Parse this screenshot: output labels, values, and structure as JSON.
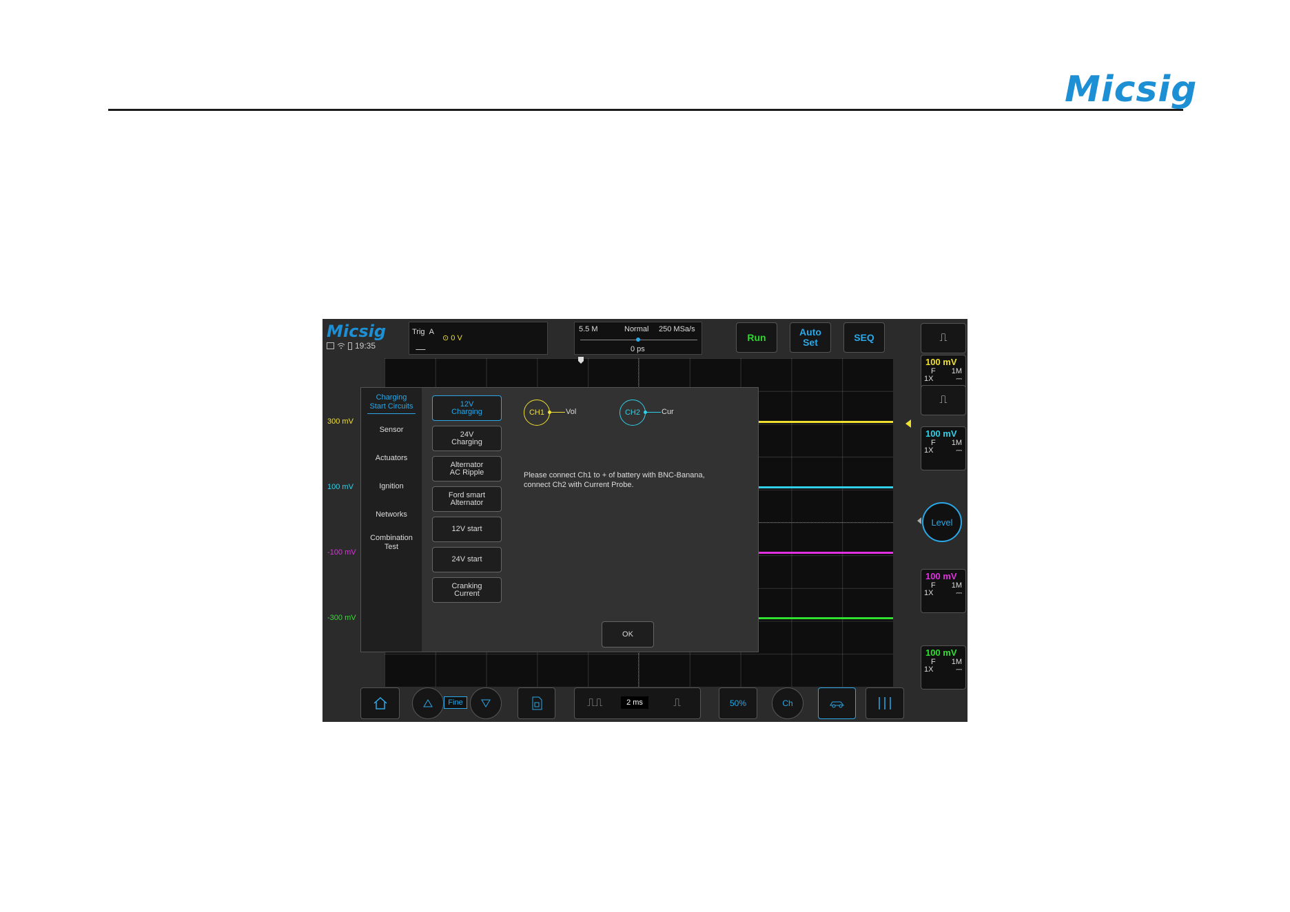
{
  "brand": {
    "logo_text": "Micsig"
  },
  "scope": {
    "logo_text": "Micsig",
    "time": "19:35",
    "trigger": {
      "label": "Trig",
      "source": "A",
      "level": "0 V"
    },
    "timebase": {
      "memory": "5.5 M",
      "mode": "Normal",
      "sample_rate": "250 MSa/s",
      "position": "0 ps"
    },
    "top_buttons": {
      "run": "Run",
      "auto_set": "Auto\nSet",
      "seq": "SEQ"
    },
    "scale_labels": [
      {
        "text": "300 mV",
        "color": "#f0e030"
      },
      {
        "text": "100 mV",
        "color": "#30d0e8"
      },
      {
        "text": "-100 mV",
        "color": "#e030e0"
      },
      {
        "text": "-300 mV",
        "color": "#30e030"
      }
    ],
    "channels": [
      {
        "volts": "100 mV",
        "coupling": "F",
        "impedance": "1M",
        "probe": "1X",
        "dc": "⎓",
        "color": "#f0e030"
      },
      {
        "volts": "100 mV",
        "coupling": "F",
        "impedance": "1M",
        "probe": "1X",
        "dc": "⎓",
        "color": "#30d0e8"
      },
      {
        "volts": "100 mV",
        "coupling": "F",
        "impedance": "1M",
        "probe": "1X",
        "dc": "⎓",
        "color": "#e030e0"
      },
      {
        "volts": "100 mV",
        "coupling": "F",
        "impedance": "1M",
        "probe": "1X",
        "dc": "⎓",
        "color": "#30e030"
      }
    ],
    "level_button": "Level",
    "dialog": {
      "categories": [
        "Charging\nStart Circuits",
        "Sensor",
        "Actuators",
        "Ignition",
        "Networks",
        "Combination\nTest"
      ],
      "options": [
        "12V\nCharging",
        "24V\nCharging",
        "Alternator\nAC Ripple",
        "Ford smart\nAlternator",
        "12V start",
        "24V start",
        "Cranking\nCurrent"
      ],
      "ch1_label": "CH1",
      "ch1_signal": "Vol",
      "ch2_label": "CH2",
      "ch2_signal": "Cur",
      "instruction": "Please connect Ch1 to + of battery with BNC-Banana,\nconnect Ch2 with Current Probe.",
      "ok": "OK"
    },
    "bottom": {
      "fine": "Fine",
      "timebase": "2 ms",
      "btn_50": "50%",
      "btn_ch": "Ch"
    }
  }
}
